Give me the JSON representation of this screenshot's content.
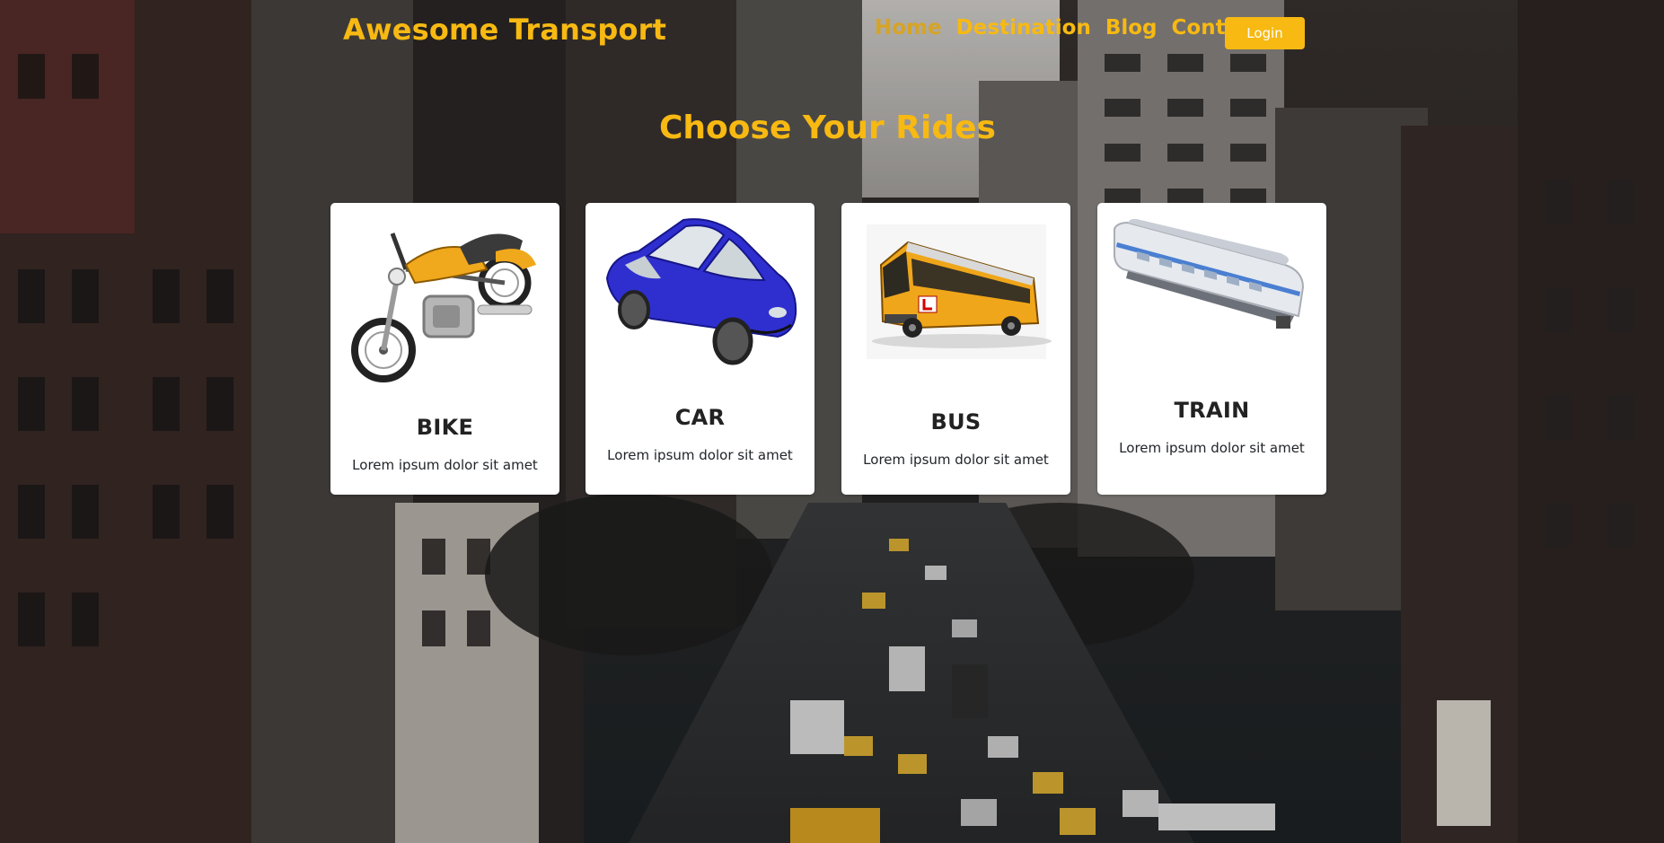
{
  "header": {
    "brand": "Awesome Transport",
    "nav": [
      "Home",
      "Destination",
      "Blog",
      "Contact"
    ],
    "login_label": "Login"
  },
  "main": {
    "title": "Choose Your Rides",
    "cards": [
      {
        "title": "BIKE",
        "text": "Lorem ipsum dolor sit amet",
        "image": "motorcycle"
      },
      {
        "title": "CAR",
        "text": "Lorem ipsum dolor sit amet",
        "image": "car"
      },
      {
        "title": "BUS",
        "text": "Lorem ipsum dolor sit amet",
        "image": "bus"
      },
      {
        "title": "TRAIN",
        "text": "Lorem ipsum dolor sit amet",
        "image": "train-carriage"
      }
    ]
  },
  "colors": {
    "accent": "#f7b912",
    "card_bg": "#ffffff",
    "card_text": "#222222"
  }
}
